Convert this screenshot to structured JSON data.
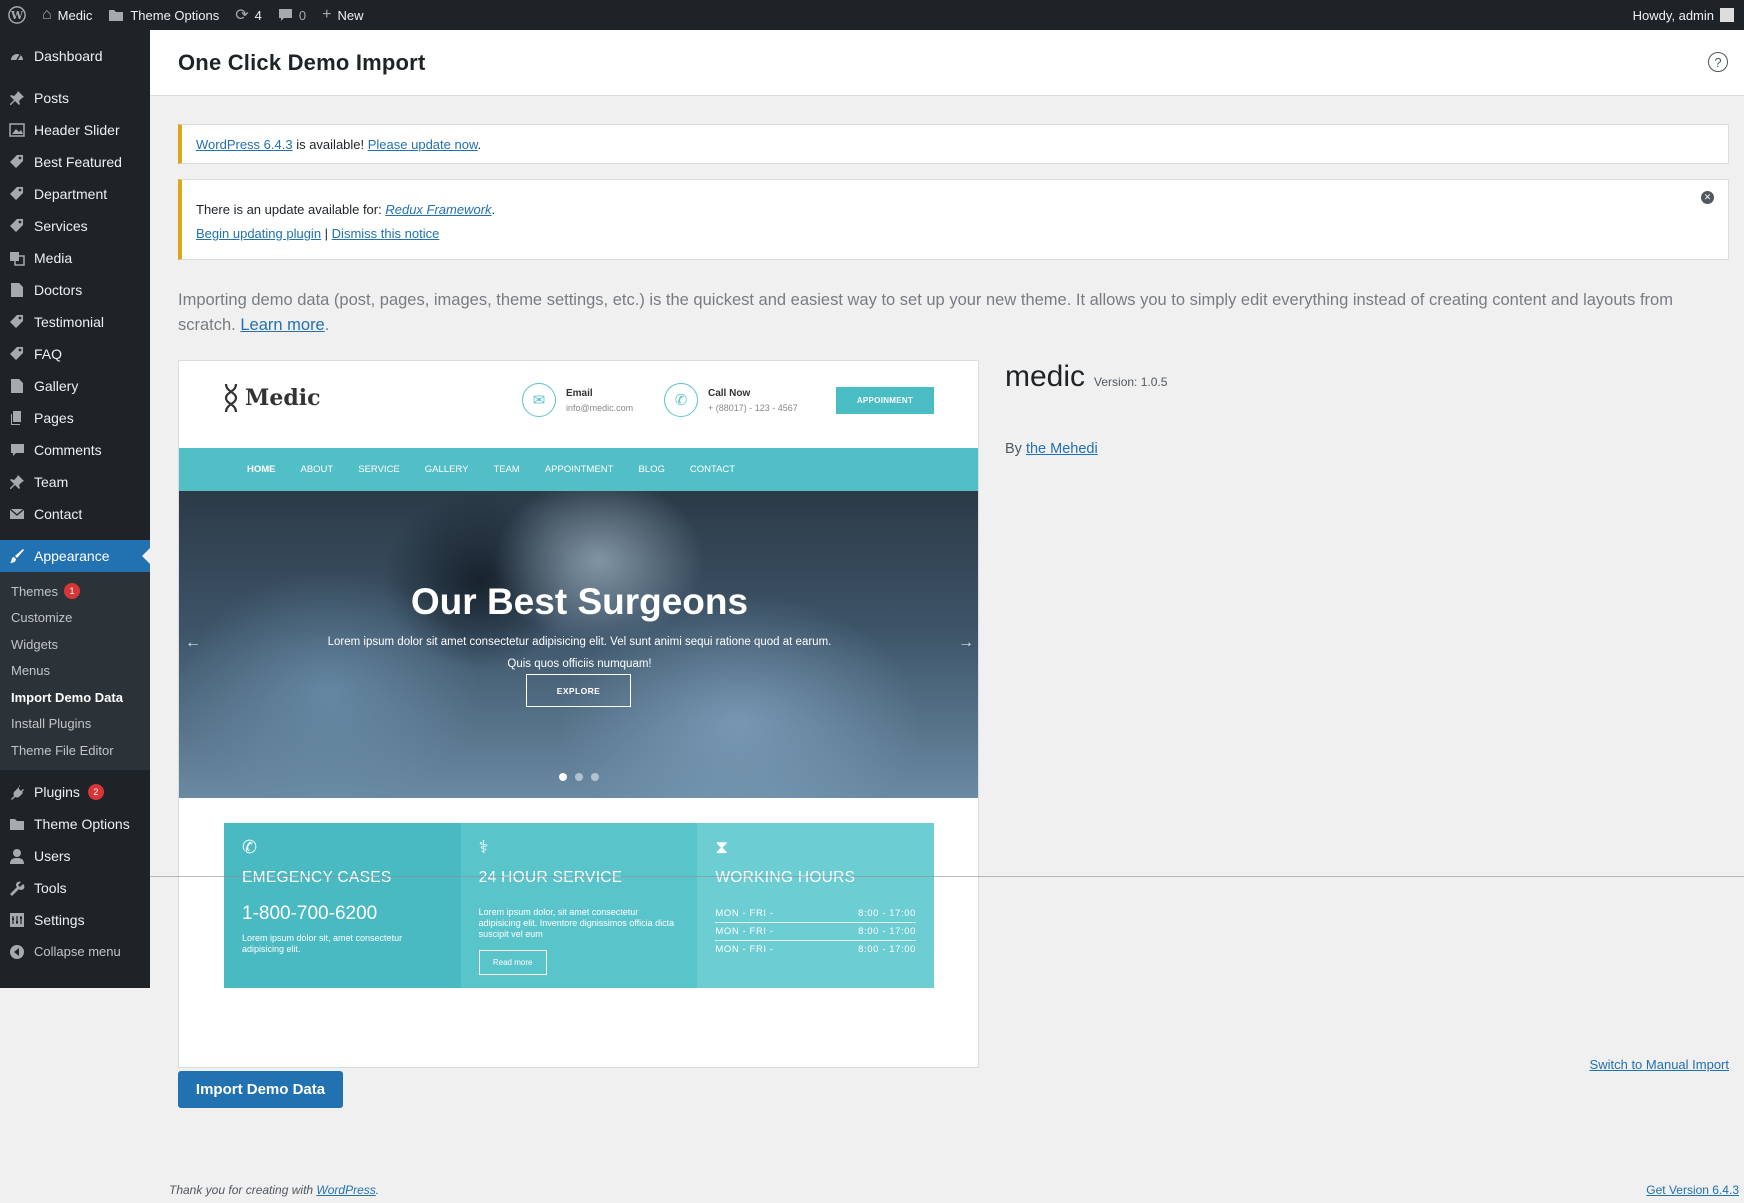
{
  "adminbar": {
    "site_name": "Medic",
    "theme_options": "Theme Options",
    "updates_count": "4",
    "comments_count": "0",
    "new_label": "New",
    "howdy": "Howdy, admin"
  },
  "sidebar": {
    "items_top": [
      {
        "label": "Dashboard",
        "icon": "dashboard-icon"
      },
      {
        "label": "Posts",
        "icon": "pin-icon"
      },
      {
        "label": "Header Slider",
        "icon": "image-icon"
      },
      {
        "label": "Best Featured",
        "icon": "tag-icon"
      },
      {
        "label": "Department",
        "icon": "tag-icon"
      },
      {
        "label": "Services",
        "icon": "tag-icon"
      },
      {
        "label": "Media",
        "icon": "media-icon"
      },
      {
        "label": "Doctors",
        "icon": "page-icon"
      },
      {
        "label": "Testimonial",
        "icon": "tag-icon"
      },
      {
        "label": "FAQ",
        "icon": "tag-icon"
      },
      {
        "label": "Gallery",
        "icon": "page-icon"
      },
      {
        "label": "Pages",
        "icon": "pages-icon"
      },
      {
        "label": "Comments",
        "icon": "comment-icon"
      },
      {
        "label": "Team",
        "icon": "pin-icon"
      },
      {
        "label": "Contact",
        "icon": "mail-icon"
      }
    ],
    "appearance": "Appearance",
    "submenu": [
      {
        "label": "Themes",
        "badge": "1"
      },
      {
        "label": "Customize"
      },
      {
        "label": "Widgets"
      },
      {
        "label": "Menus"
      },
      {
        "label": "Import Demo Data"
      },
      {
        "label": "Install Plugins"
      },
      {
        "label": "Theme File Editor"
      }
    ],
    "items_bottom": [
      {
        "label": "Plugins",
        "badge": "2",
        "icon": "plugin-icon"
      },
      {
        "label": "Theme Options",
        "icon": "folder-icon"
      },
      {
        "label": "Users",
        "icon": "user-icon"
      },
      {
        "label": "Tools",
        "icon": "wrench-icon"
      },
      {
        "label": "Settings",
        "icon": "settings-icon"
      },
      {
        "label": "Collapse menu",
        "icon": "collapse-icon"
      }
    ]
  },
  "page": {
    "title": "One Click Demo Import",
    "notice1": {
      "link1": "WordPress 6.4.3",
      "text": " is available! ",
      "link2": "Please update now",
      "end": "."
    },
    "notice2": {
      "text": "There is an update available for: ",
      "plugin": "Redux Framework",
      "end": ".",
      "begin": "Begin updating plugin",
      "sep": " | ",
      "dismiss": "Dismiss this notice"
    },
    "intro": "Importing demo data (post, pages, images, theme settings, etc.) is the quickest and easiest way to set up your new theme. It allows you to simply edit everything instead of creating content and layouts from scratch. ",
    "learn_more": "Learn more",
    "learn_more_end": ".",
    "theme_name": "medic",
    "theme_version": "Version: 1.0.5",
    "author_prefix": "By ",
    "author": "the Mehedi",
    "switch_link": "Switch to Manual Import",
    "import_button": "Import Demo Data"
  },
  "preview": {
    "logo": "Medic",
    "email_title": "Email",
    "email_value": "info@medic.com",
    "call_title": "Call Now",
    "call_value": "+ (88017) - 123 - 4567",
    "appointment": "APPOINMENT",
    "nav": [
      "HOME",
      "ABOUT",
      "SERVICE",
      "GALLERY",
      "TEAM",
      "APPOINTMENT",
      "BLOG",
      "CONTACT"
    ],
    "hero_title": "Our Best Surgeons",
    "hero_line1": "Lorem ipsum dolor sit amet consectetur adipisicing elit. Vel sunt animi sequi ratione quod at earum.",
    "hero_line2": "Quis quos officiis numquam!",
    "explore": "EXPLORE",
    "box1": {
      "title": "EMEGENCY CASES",
      "phone": "1-800-700-6200",
      "text": "Lorem ipsum dolor sit, amet consectetur adipisicing elit.",
      "color": "#49bac2"
    },
    "box2": {
      "title": "24 HOUR SERVICE",
      "text": "Lorem ipsum dolor, sit amet consectetur adipisicing elit. Inventore dignissimos officia dicta suscipit vel eum",
      "readmore": "Read more",
      "color": "#5ac4cb"
    },
    "box3": {
      "title": "WORKING HOURS",
      "hours": [
        {
          "day": "MON - FRI -",
          "time": "8:00 - 17:00"
        },
        {
          "day": "MON - FRI -",
          "time": "8:00 - 17:00"
        },
        {
          "day": "MON - FRI -",
          "time": "8:00 - 17:00"
        }
      ],
      "color": "#6ccdd3"
    }
  },
  "footer": {
    "thanks": "Thank you for creating with ",
    "wp": "WordPress",
    "end": ".",
    "version": "Get Version 6.4.3"
  }
}
